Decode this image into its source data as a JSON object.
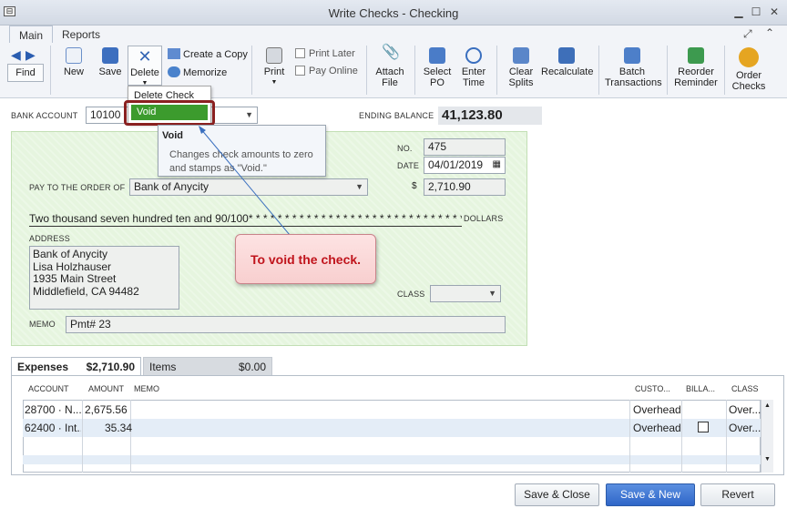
{
  "window": {
    "title": "Write Checks - Checking"
  },
  "ribbon": {
    "tabs": [
      "Main",
      "Reports"
    ],
    "find": "Find",
    "new": "New",
    "save": "Save",
    "delete": "Delete",
    "create_copy": "Create a Copy",
    "memorize": "Memorize",
    "print": "Print",
    "print_later": "Print Later",
    "pay_online": "Pay Online",
    "attach_file": [
      "Attach",
      "File"
    ],
    "select_po": [
      "Select",
      "PO"
    ],
    "enter_time": [
      "Enter",
      "Time"
    ],
    "clear_splits": [
      "Clear",
      "Splits"
    ],
    "recalculate": "Recalculate",
    "batch_transactions": [
      "Batch",
      "Transactions"
    ],
    "reorder_reminder": [
      "Reorder",
      "Reminder"
    ],
    "order_checks": [
      "Order",
      "Checks"
    ]
  },
  "delete_menu": {
    "items": [
      "Delete Check",
      "Void"
    ]
  },
  "tooltip": {
    "title": "Void",
    "body_line1": "Changes check amounts to zero",
    "body_line2": "and stamps as \"Void.\""
  },
  "header": {
    "bank_account_label": "BANK ACCOUNT",
    "bank_account_value": "10100 ·",
    "ending_balance_label": "ENDING BALANCE",
    "ending_balance_value": "41,123.80"
  },
  "check": {
    "no_label": "NO.",
    "no_value": "475",
    "date_label": "DATE",
    "date_value": "04/01/2019",
    "pay_to_label": "PAY TO THE ORDER OF",
    "pay_to_value": "Bank of Anycity",
    "amount_symbol": "$",
    "amount_value": "2,710.90",
    "amount_words": "Two thousand seven hundred ten and 90/100* * * * * * * * * * * * * * * * * * * * * * * * * * * * * * * * * * * * *",
    "dollars_label": "DOLLARS",
    "address_label": "ADDRESS",
    "address_lines": [
      "Bank of Anycity",
      "Lisa Holzhauser",
      "1935 Main Street",
      "Middlefield, CA 94482"
    ],
    "class_label": "CLASS",
    "memo_label": "MEMO",
    "memo_value": "Pmt# 23"
  },
  "callout": {
    "text": "To void the check."
  },
  "lower_tabs": {
    "expenses_label": "Expenses",
    "expenses_amount": "$2,710.90",
    "items_label": "Items",
    "items_amount": "$0.00"
  },
  "grid": {
    "headers": [
      "ACCOUNT",
      "AMOUNT",
      "MEMO",
      "CUSTO...",
      "BILLA...",
      "CLASS"
    ],
    "rows": [
      {
        "account": "28700 · N...",
        "amount": "2,675.56",
        "memo": "",
        "customer": "Overhead",
        "billable": "",
        "class": "Over..."
      },
      {
        "account": "62400 · Int...",
        "amount": "35.34",
        "memo": "",
        "customer": "Overhead",
        "billable": "checkbox",
        "class": "Over..."
      }
    ]
  },
  "buttons": {
    "save_close": "Save & Close",
    "save_new": "Save & New",
    "revert": "Revert"
  },
  "colors": {
    "void_highlight": "#3c9b2d",
    "callout_text": "#c0141c",
    "check_bg": "#e6f5df"
  }
}
